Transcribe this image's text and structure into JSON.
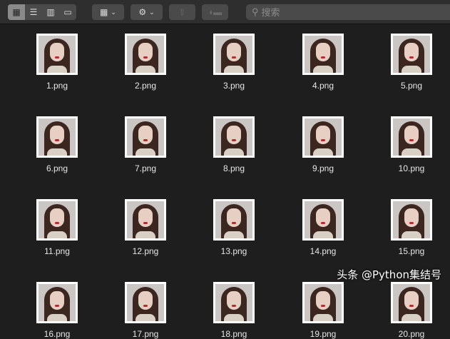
{
  "toolbar": {
    "view_modes": [
      "icon-view",
      "list-view",
      "column-view",
      "gallery-view"
    ],
    "active_view": "icon-view",
    "search_placeholder": "搜索"
  },
  "files": [
    "1.png",
    "2.png",
    "3.png",
    "4.png",
    "5.png",
    "6.png",
    "7.png",
    "8.png",
    "9.png",
    "10.png",
    "11.png",
    "12.png",
    "13.png",
    "14.png",
    "15.png",
    "16.png",
    "17.png",
    "18.png",
    "19.png",
    "20.png"
  ],
  "watermark": "头条 @Python集结号"
}
